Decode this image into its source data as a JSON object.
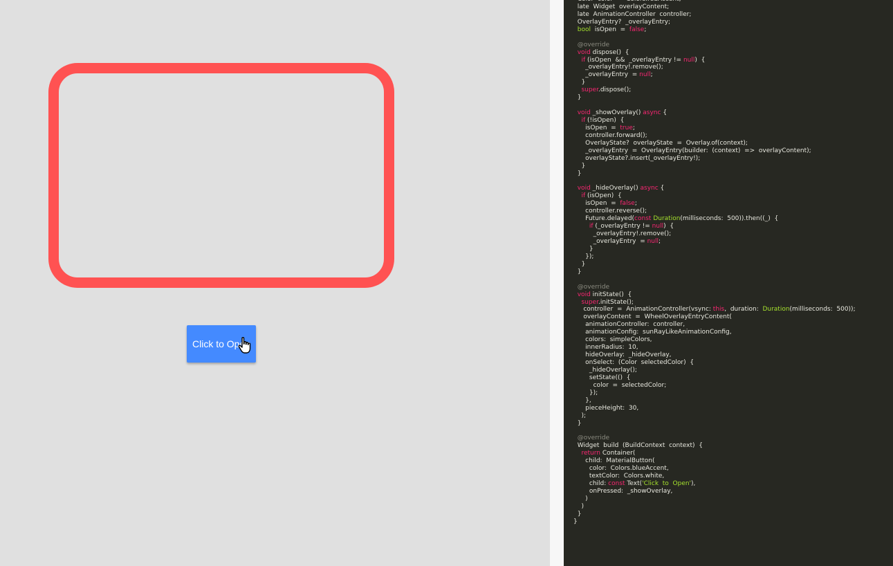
{
  "app": {
    "button_label": "Click to Open",
    "box_color": "#ff5252",
    "button_color": "#448aff",
    "cursor_icon": "hand-pointer-icon"
  },
  "editor": {
    "theme": {
      "keyword": "#f92672",
      "type": "#a6e22e",
      "comment": "#8b8b80",
      "string": "#a6e22e",
      "text": "#e9e9e0",
      "background": "#272822"
    },
    "lines": [
      [
        [
          2,
          "tx",
          "Color  color  =  Colors.redAccent;"
        ]
      ],
      [
        [
          2,
          "tx",
          "late  Widget  overlayContent;"
        ]
      ],
      [
        [
          2,
          "tx",
          "late  AnimationController  controller;"
        ]
      ],
      [
        [
          2,
          "tx",
          "OverlayEntry?  _overlayEntry;"
        ]
      ],
      [
        [
          2,
          "ty",
          "bool"
        ],
        [
          0,
          "tx",
          "  isOpen  =  "
        ],
        [
          0,
          "kw",
          "false"
        ],
        [
          0,
          "tx",
          ";"
        ]
      ],
      [],
      [
        [
          2,
          "cm",
          "@override"
        ]
      ],
      [
        [
          2,
          "kw",
          "void"
        ],
        [
          0,
          "tx",
          " dispose()  {"
        ]
      ],
      [
        [
          4,
          "kw",
          "if"
        ],
        [
          0,
          "tx",
          " (isOpen  &&  _overlayEntry != "
        ],
        [
          0,
          "kw",
          "null"
        ],
        [
          0,
          "tx",
          ")  {"
        ]
      ],
      [
        [
          6,
          "tx",
          "_overlayEntry!.remove();"
        ]
      ],
      [
        [
          6,
          "tx",
          "_overlayEntry  = "
        ],
        [
          0,
          "kw",
          "null"
        ],
        [
          0,
          "tx",
          ";"
        ]
      ],
      [
        [
          4,
          "tx",
          "}"
        ]
      ],
      [
        [
          4,
          "kw",
          "super"
        ],
        [
          0,
          "tx",
          ".dispose();"
        ]
      ],
      [
        [
          2,
          "tx",
          "}"
        ]
      ],
      [],
      [
        [
          2,
          "kw",
          "void"
        ],
        [
          0,
          "tx",
          " _showOverlay() "
        ],
        [
          0,
          "kw",
          "async"
        ],
        [
          0,
          "tx",
          " {"
        ]
      ],
      [
        [
          4,
          "kw",
          "if"
        ],
        [
          0,
          "tx",
          " (!isOpen)  {"
        ]
      ],
      [
        [
          6,
          "tx",
          "isOpen  =  "
        ],
        [
          0,
          "kw",
          "true"
        ],
        [
          0,
          "tx",
          ";"
        ]
      ],
      [
        [
          6,
          "tx",
          "controller.forward();"
        ]
      ],
      [
        [
          6,
          "tx",
          "OverlayState?  overlayState  =  Overlay.of(context);"
        ]
      ],
      [
        [
          6,
          "tx",
          "_overlayEntry  =  OverlayEntry(builder:  (context)  =>  overlayContent);"
        ]
      ],
      [
        [
          6,
          "tx",
          "overlayState?.insert(_overlayEntry!);"
        ]
      ],
      [
        [
          4,
          "tx",
          "}"
        ]
      ],
      [
        [
          2,
          "tx",
          "}"
        ]
      ],
      [],
      [
        [
          2,
          "kw",
          "void"
        ],
        [
          0,
          "tx",
          " _hideOverlay() "
        ],
        [
          0,
          "kw",
          "async"
        ],
        [
          0,
          "tx",
          " {"
        ]
      ],
      [
        [
          4,
          "kw",
          "if"
        ],
        [
          0,
          "tx",
          " (isOpen)  {"
        ]
      ],
      [
        [
          6,
          "tx",
          "isOpen  =  "
        ],
        [
          0,
          "kw",
          "false"
        ],
        [
          0,
          "tx",
          ";"
        ]
      ],
      [
        [
          6,
          "tx",
          "controller.reverse();"
        ]
      ],
      [
        [
          6,
          "tx",
          "Future.delayed("
        ],
        [
          0,
          "kw",
          "const"
        ],
        [
          0,
          "tx",
          " "
        ],
        [
          0,
          "ty",
          "Duration"
        ],
        [
          0,
          "tx",
          "(milliseconds:  500)).then((_)  {"
        ]
      ],
      [
        [
          8,
          "kw",
          "if"
        ],
        [
          0,
          "tx",
          " (_overlayEntry != "
        ],
        [
          0,
          "kw",
          "null"
        ],
        [
          0,
          "tx",
          ")  {"
        ]
      ],
      [
        [
          10,
          "tx",
          "_overlayEntry!.remove();"
        ]
      ],
      [
        [
          10,
          "tx",
          "_overlayEntry  = "
        ],
        [
          0,
          "kw",
          "null"
        ],
        [
          0,
          "tx",
          ";"
        ]
      ],
      [
        [
          8,
          "tx",
          "}"
        ]
      ],
      [
        [
          6,
          "tx",
          "});"
        ]
      ],
      [
        [
          4,
          "tx",
          "}"
        ]
      ],
      [
        [
          2,
          "tx",
          "}"
        ]
      ],
      [],
      [
        [
          2,
          "cm",
          "@override"
        ]
      ],
      [
        [
          2,
          "kw",
          "void"
        ],
        [
          0,
          "tx",
          " initState()  {"
        ]
      ],
      [
        [
          4,
          "kw",
          "super"
        ],
        [
          0,
          "tx",
          ".initState();"
        ]
      ],
      [
        [
          5,
          "tx",
          "controller  =  AnimationController(vsync: "
        ],
        [
          0,
          "kw",
          "this"
        ],
        [
          0,
          "tx",
          ",  duration:  "
        ],
        [
          0,
          "ty",
          "Duration"
        ],
        [
          0,
          "tx",
          "(milliseconds:  500));"
        ]
      ],
      [
        [
          5,
          "tx",
          "overlayContent  =  WheelOverlayEntryContent("
        ]
      ],
      [
        [
          6,
          "tx",
          "animationController:  controller,"
        ]
      ],
      [
        [
          6,
          "tx",
          "animationConfig:  sunRayLikeAnimationConfig,"
        ]
      ],
      [
        [
          6,
          "tx",
          "colors:  simpleColors,"
        ]
      ],
      [
        [
          6,
          "tx",
          "innerRadius:  10,"
        ]
      ],
      [
        [
          6,
          "tx",
          "hideOverlay:  _hideOverlay,"
        ]
      ],
      [
        [
          6,
          "tx",
          "onSelect:  (Color  selectedColor)  {"
        ]
      ],
      [
        [
          8,
          "tx",
          "_hideOverlay();"
        ]
      ],
      [
        [
          8,
          "tx",
          "setState(()  {"
        ]
      ],
      [
        [
          10,
          "tx",
          "color  =  selectedColor;"
        ]
      ],
      [
        [
          8,
          "tx",
          "});"
        ]
      ],
      [
        [
          6,
          "tx",
          "},"
        ]
      ],
      [
        [
          6,
          "tx",
          "pieceHeight:  30,"
        ]
      ],
      [
        [
          4,
          "tx",
          ");"
        ]
      ],
      [
        [
          2,
          "tx",
          "}"
        ]
      ],
      [],
      [
        [
          2,
          "cm",
          "@override"
        ]
      ],
      [
        [
          2,
          "tx",
          "Widget  build  (BuildContext  context)  {"
        ]
      ],
      [
        [
          4,
          "kw",
          "return"
        ],
        [
          0,
          "tx",
          " Container("
        ]
      ],
      [
        [
          6,
          "tx",
          "child:  MaterialButton("
        ]
      ],
      [
        [
          8,
          "tx",
          "color:  Colors.blueAccent,"
        ]
      ],
      [
        [
          8,
          "tx",
          "textColor:  Colors.white,"
        ]
      ],
      [
        [
          8,
          "tx",
          "child: "
        ],
        [
          0,
          "kw",
          "const"
        ],
        [
          0,
          "tx",
          " Text("
        ],
        [
          0,
          "st",
          "'Click  to  Open'"
        ],
        [
          0,
          "tx",
          "),"
        ]
      ],
      [
        [
          8,
          "tx",
          "onPressed:  _showOverlay,"
        ]
      ],
      [
        [
          6,
          "tx",
          ")"
        ]
      ],
      [
        [
          4,
          "tx",
          ")"
        ]
      ],
      [
        [
          2,
          "tx",
          "}"
        ]
      ],
      [
        [
          0,
          "tx",
          "}"
        ]
      ]
    ]
  }
}
